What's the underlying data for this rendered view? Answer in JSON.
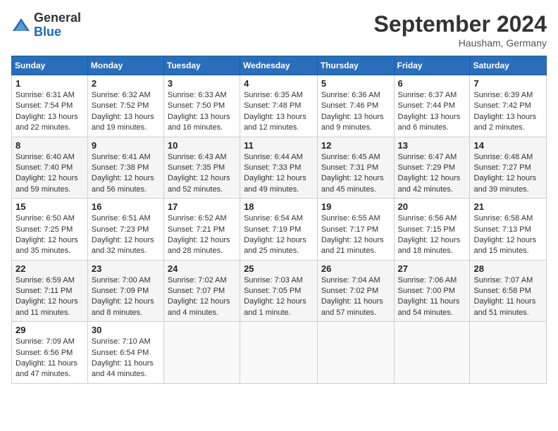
{
  "header": {
    "logo_general": "General",
    "logo_blue": "Blue",
    "month_title": "September 2024",
    "location": "Hausham, Germany"
  },
  "weekdays": [
    "Sunday",
    "Monday",
    "Tuesday",
    "Wednesday",
    "Thursday",
    "Friday",
    "Saturday"
  ],
  "weeks": [
    [
      {
        "day": "1",
        "sunrise": "6:31 AM",
        "sunset": "7:54 PM",
        "daylight": "13 hours and 22 minutes."
      },
      {
        "day": "2",
        "sunrise": "6:32 AM",
        "sunset": "7:52 PM",
        "daylight": "13 hours and 19 minutes."
      },
      {
        "day": "3",
        "sunrise": "6:33 AM",
        "sunset": "7:50 PM",
        "daylight": "13 hours and 16 minutes."
      },
      {
        "day": "4",
        "sunrise": "6:35 AM",
        "sunset": "7:48 PM",
        "daylight": "13 hours and 12 minutes."
      },
      {
        "day": "5",
        "sunrise": "6:36 AM",
        "sunset": "7:46 PM",
        "daylight": "13 hours and 9 minutes."
      },
      {
        "day": "6",
        "sunrise": "6:37 AM",
        "sunset": "7:44 PM",
        "daylight": "13 hours and 6 minutes."
      },
      {
        "day": "7",
        "sunrise": "6:39 AM",
        "sunset": "7:42 PM",
        "daylight": "13 hours and 2 minutes."
      }
    ],
    [
      {
        "day": "8",
        "sunrise": "6:40 AM",
        "sunset": "7:40 PM",
        "daylight": "12 hours and 59 minutes."
      },
      {
        "day": "9",
        "sunrise": "6:41 AM",
        "sunset": "7:38 PM",
        "daylight": "12 hours and 56 minutes."
      },
      {
        "day": "10",
        "sunrise": "6:43 AM",
        "sunset": "7:35 PM",
        "daylight": "12 hours and 52 minutes."
      },
      {
        "day": "11",
        "sunrise": "6:44 AM",
        "sunset": "7:33 PM",
        "daylight": "12 hours and 49 minutes."
      },
      {
        "day": "12",
        "sunrise": "6:45 AM",
        "sunset": "7:31 PM",
        "daylight": "12 hours and 45 minutes."
      },
      {
        "day": "13",
        "sunrise": "6:47 AM",
        "sunset": "7:29 PM",
        "daylight": "12 hours and 42 minutes."
      },
      {
        "day": "14",
        "sunrise": "6:48 AM",
        "sunset": "7:27 PM",
        "daylight": "12 hours and 39 minutes."
      }
    ],
    [
      {
        "day": "15",
        "sunrise": "6:50 AM",
        "sunset": "7:25 PM",
        "daylight": "12 hours and 35 minutes."
      },
      {
        "day": "16",
        "sunrise": "6:51 AM",
        "sunset": "7:23 PM",
        "daylight": "12 hours and 32 minutes."
      },
      {
        "day": "17",
        "sunrise": "6:52 AM",
        "sunset": "7:21 PM",
        "daylight": "12 hours and 28 minutes."
      },
      {
        "day": "18",
        "sunrise": "6:54 AM",
        "sunset": "7:19 PM",
        "daylight": "12 hours and 25 minutes."
      },
      {
        "day": "19",
        "sunrise": "6:55 AM",
        "sunset": "7:17 PM",
        "daylight": "12 hours and 21 minutes."
      },
      {
        "day": "20",
        "sunrise": "6:56 AM",
        "sunset": "7:15 PM",
        "daylight": "12 hours and 18 minutes."
      },
      {
        "day": "21",
        "sunrise": "6:58 AM",
        "sunset": "7:13 PM",
        "daylight": "12 hours and 15 minutes."
      }
    ],
    [
      {
        "day": "22",
        "sunrise": "6:59 AM",
        "sunset": "7:11 PM",
        "daylight": "12 hours and 11 minutes."
      },
      {
        "day": "23",
        "sunrise": "7:00 AM",
        "sunset": "7:09 PM",
        "daylight": "12 hours and 8 minutes."
      },
      {
        "day": "24",
        "sunrise": "7:02 AM",
        "sunset": "7:07 PM",
        "daylight": "12 hours and 4 minutes."
      },
      {
        "day": "25",
        "sunrise": "7:03 AM",
        "sunset": "7:05 PM",
        "daylight": "12 hours and 1 minute."
      },
      {
        "day": "26",
        "sunrise": "7:04 AM",
        "sunset": "7:02 PM",
        "daylight": "11 hours and 57 minutes."
      },
      {
        "day": "27",
        "sunrise": "7:06 AM",
        "sunset": "7:00 PM",
        "daylight": "11 hours and 54 minutes."
      },
      {
        "day": "28",
        "sunrise": "7:07 AM",
        "sunset": "6:58 PM",
        "daylight": "11 hours and 51 minutes."
      }
    ],
    [
      {
        "day": "29",
        "sunrise": "7:09 AM",
        "sunset": "6:56 PM",
        "daylight": "11 hours and 47 minutes."
      },
      {
        "day": "30",
        "sunrise": "7:10 AM",
        "sunset": "6:54 PM",
        "daylight": "11 hours and 44 minutes."
      },
      null,
      null,
      null,
      null,
      null
    ]
  ]
}
